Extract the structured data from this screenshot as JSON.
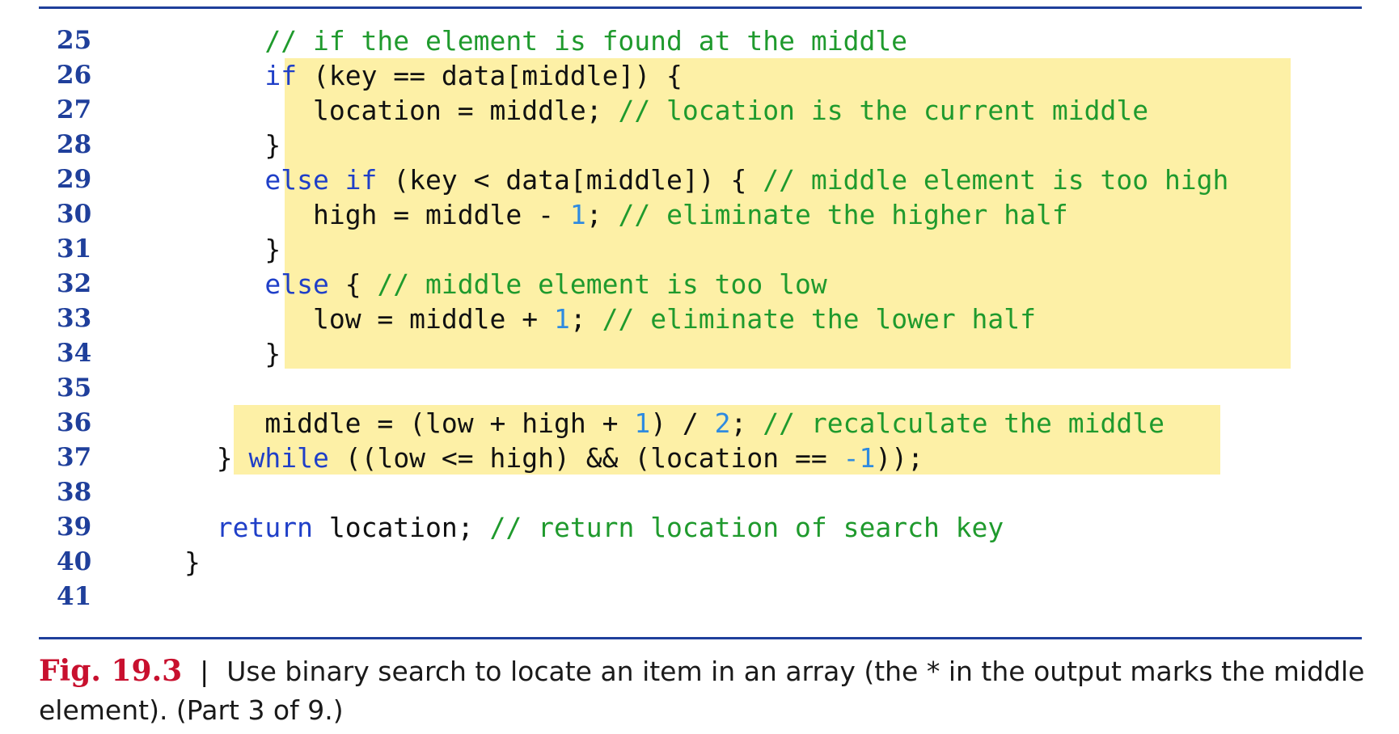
{
  "code_lines": [
    {
      "n": "25",
      "indent": 2,
      "tokens": [
        {
          "t": "cm",
          "s": "// if the element is found at the middle"
        }
      ]
    },
    {
      "n": "26",
      "indent": 2,
      "tokens": [
        {
          "t": "kw",
          "s": "if"
        },
        {
          "t": "tx",
          "s": " (key == data[middle]) {"
        }
      ]
    },
    {
      "n": "27",
      "indent": 3,
      "tokens": [
        {
          "t": "tx",
          "s": "location = middle; "
        },
        {
          "t": "cm",
          "s": "// location is the current middle"
        }
      ]
    },
    {
      "n": "28",
      "indent": 2,
      "tokens": [
        {
          "t": "tx",
          "s": "}"
        }
      ]
    },
    {
      "n": "29",
      "indent": 2,
      "tokens": [
        {
          "t": "kw",
          "s": "else if"
        },
        {
          "t": "tx",
          "s": " (key < data[middle]) { "
        },
        {
          "t": "cm",
          "s": "// middle element is too high"
        }
      ]
    },
    {
      "n": "30",
      "indent": 3,
      "tokens": [
        {
          "t": "tx",
          "s": "high = middle - "
        },
        {
          "t": "num",
          "s": "1"
        },
        {
          "t": "tx",
          "s": "; "
        },
        {
          "t": "cm",
          "s": "// eliminate the higher half"
        }
      ]
    },
    {
      "n": "31",
      "indent": 2,
      "tokens": [
        {
          "t": "tx",
          "s": "}"
        }
      ]
    },
    {
      "n": "32",
      "indent": 2,
      "tokens": [
        {
          "t": "kw",
          "s": "else"
        },
        {
          "t": "tx",
          "s": " { "
        },
        {
          "t": "cm",
          "s": "// middle element is too low"
        }
      ]
    },
    {
      "n": "33",
      "indent": 3,
      "tokens": [
        {
          "t": "tx",
          "s": "low = middle + "
        },
        {
          "t": "num",
          "s": "1"
        },
        {
          "t": "tx",
          "s": "; "
        },
        {
          "t": "cm",
          "s": "// eliminate the lower half"
        }
      ]
    },
    {
      "n": "34",
      "indent": 2,
      "tokens": [
        {
          "t": "tx",
          "s": "}"
        }
      ]
    },
    {
      "n": "35",
      "indent": 0,
      "tokens": []
    },
    {
      "n": "36",
      "indent": 2,
      "tokens": [
        {
          "t": "tx",
          "s": "middle = (low + high + "
        },
        {
          "t": "num",
          "s": "1"
        },
        {
          "t": "tx",
          "s": ") / "
        },
        {
          "t": "num",
          "s": "2"
        },
        {
          "t": "tx",
          "s": "; "
        },
        {
          "t": "cm",
          "s": "// recalculate the middle"
        }
      ]
    },
    {
      "n": "37",
      "indent": 1,
      "tokens": [
        {
          "t": "tx",
          "s": "} "
        },
        {
          "t": "kw",
          "s": "while"
        },
        {
          "t": "tx",
          "s": " ((low <= high) && (location == "
        },
        {
          "t": "num",
          "s": "-1"
        },
        {
          "t": "tx",
          "s": "));"
        }
      ]
    },
    {
      "n": "38",
      "indent": 0,
      "tokens": []
    },
    {
      "n": "39",
      "indent": 1,
      "tokens": [
        {
          "t": "kw",
          "s": "return"
        },
        {
          "t": "tx",
          "s": " location; "
        },
        {
          "t": "cm",
          "s": "// return location of search key"
        }
      ]
    },
    {
      "n": "40",
      "indent": 0,
      "tokens": [
        {
          "t": "tx",
          "s": "}"
        }
      ]
    },
    {
      "n": "41",
      "indent": 0,
      "tokens": []
    }
  ],
  "caption": {
    "label": "Fig. 19.3",
    "separator": "|",
    "text": "Use binary search to locate an item in an array (the * in the output marks the middle element). (Part 3 of 9.)"
  },
  "colors": {
    "rule": "#1f3f9b",
    "line_number": "#1f3f9b",
    "keyword": "#1f3fc8",
    "comment": "#1f9a2d",
    "number": "#2f8be0",
    "highlight": "#fdf0a6",
    "fig_label": "#c8102e"
  }
}
